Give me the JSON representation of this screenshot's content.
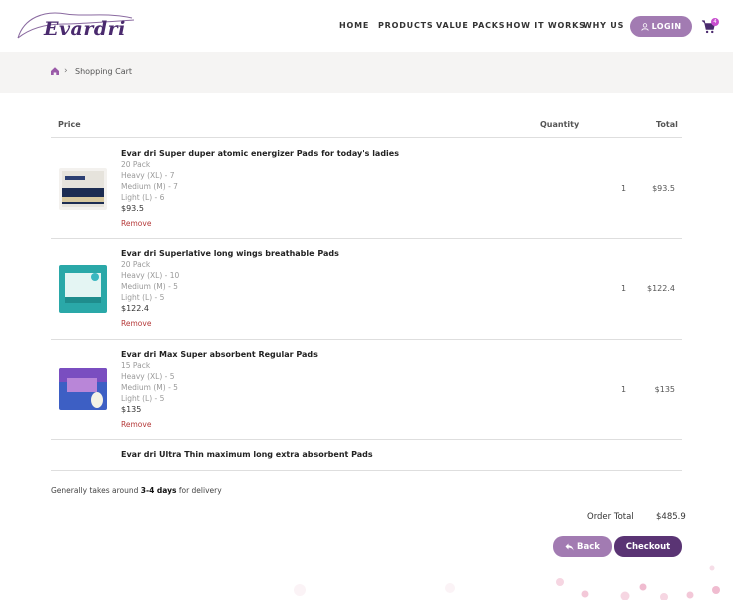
{
  "brand": {
    "name": "Evardri"
  },
  "nav": {
    "items": [
      "HOME",
      "PRODUCTS",
      "VALUE PACKS",
      "HOW IT WORKS",
      "WHY US"
    ],
    "login_label": "LOGIN"
  },
  "cart": {
    "badge": "4"
  },
  "breadcrumb": {
    "current": "Shopping Cart"
  },
  "table": {
    "headers": {
      "price": "Price",
      "quantity": "Quantity",
      "total": "Total"
    },
    "remove_label": "Remove",
    "rows": [
      {
        "name": "Evar dri Super duper atomic energizer Pads for today's ladies",
        "pack": "20 Pack",
        "details": [
          "Heavy (XL) - 7",
          "Medium (M) - 7",
          "Light (L) - 6"
        ],
        "price": "$93.5",
        "quantity": "1",
        "total": "$93.5"
      },
      {
        "name": "Evar dri Superlative long wings breathable Pads",
        "pack": "20 Pack",
        "details": [
          "Heavy (XL) - 10",
          "Medium (M) - 5",
          "Light (L) - 5"
        ],
        "price": "$122.4",
        "quantity": "1",
        "total": "$122.4"
      },
      {
        "name": "Evar dri Max Super absorbent Regular Pads",
        "pack": "15 Pack",
        "details": [
          "Heavy (XL) - 5",
          "Medium (M) - 5",
          "Light (L) - 5"
        ],
        "price": "$135",
        "quantity": "1",
        "total": "$135"
      },
      {
        "name": "Evar dri Ultra Thin maximum long extra absorbent Pads"
      }
    ]
  },
  "delivery": {
    "prefix": "Generally takes around ",
    "days": "3-4 days",
    "suffix": " for delivery"
  },
  "summary": {
    "order_total_label": "Order Total",
    "order_total": "$485.9"
  },
  "buttons": {
    "back": "Back",
    "checkout": "Checkout"
  },
  "colors": {
    "accent": "#a27bb2",
    "dark_accent": "#5a3474",
    "remove": "#b53a3a",
    "badge": "#c84ecf"
  }
}
